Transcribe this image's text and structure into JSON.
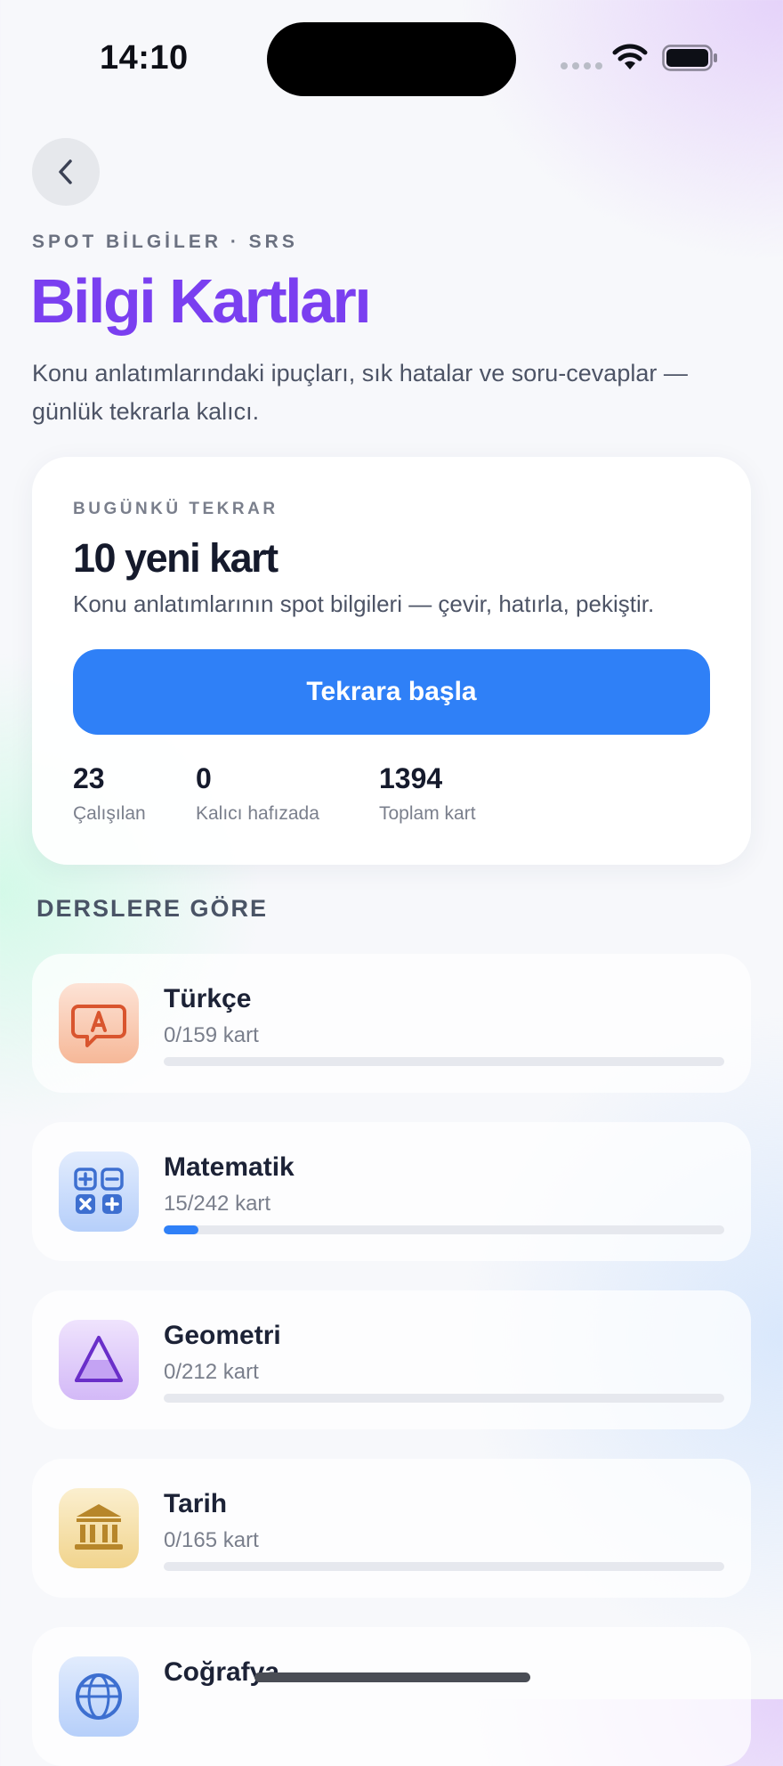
{
  "status_bar": {
    "time": "14:10"
  },
  "header": {
    "eyebrow": "SPOT BİLGİLER · SRS",
    "title": "Bilgi Kartları",
    "subtitle": "Konu anlatımlarındaki ipuçları, sık hatalar ve soru-cevaplar — günlük tekrarla kalıcı."
  },
  "today_card": {
    "eyebrow": "BUGÜNKÜ TEKRAR",
    "title": "10 yeni kart",
    "description": "Konu anlatımlarının spot bilgileri — çevir, hatırla, pekiştir.",
    "button_label": "Tekrara başla",
    "stats": [
      {
        "value": "23",
        "label": "Çalışılan"
      },
      {
        "value": "0",
        "label": "Kalıcı hafızada"
      },
      {
        "value": "1394",
        "label": "Toplam kart"
      }
    ]
  },
  "section_title": "DERSLERE GÖRE",
  "subjects": [
    {
      "name": "Türkçe",
      "count": "0/159 kart",
      "progress": 0,
      "icon": "speech-bubble-icon",
      "color": "#f07a4a"
    },
    {
      "name": "Matematik",
      "count": "15/242 kart",
      "progress": 0.062,
      "icon": "calculator-icon",
      "color": "#3d7be6"
    },
    {
      "name": "Geometri",
      "count": "0/212 kart",
      "progress": 0,
      "icon": "triangle-icon",
      "color": "#7a3fe0"
    },
    {
      "name": "Tarih",
      "count": "0/165 kart",
      "progress": 0,
      "icon": "museum-icon",
      "color": "#c99a2e"
    },
    {
      "name": "Coğrafya",
      "count": "",
      "progress": 0,
      "icon": "globe-icon",
      "color": "#3d6fd0"
    }
  ],
  "colors": {
    "accent": "#2f80f7",
    "title_purple": "#7a3ff0"
  }
}
